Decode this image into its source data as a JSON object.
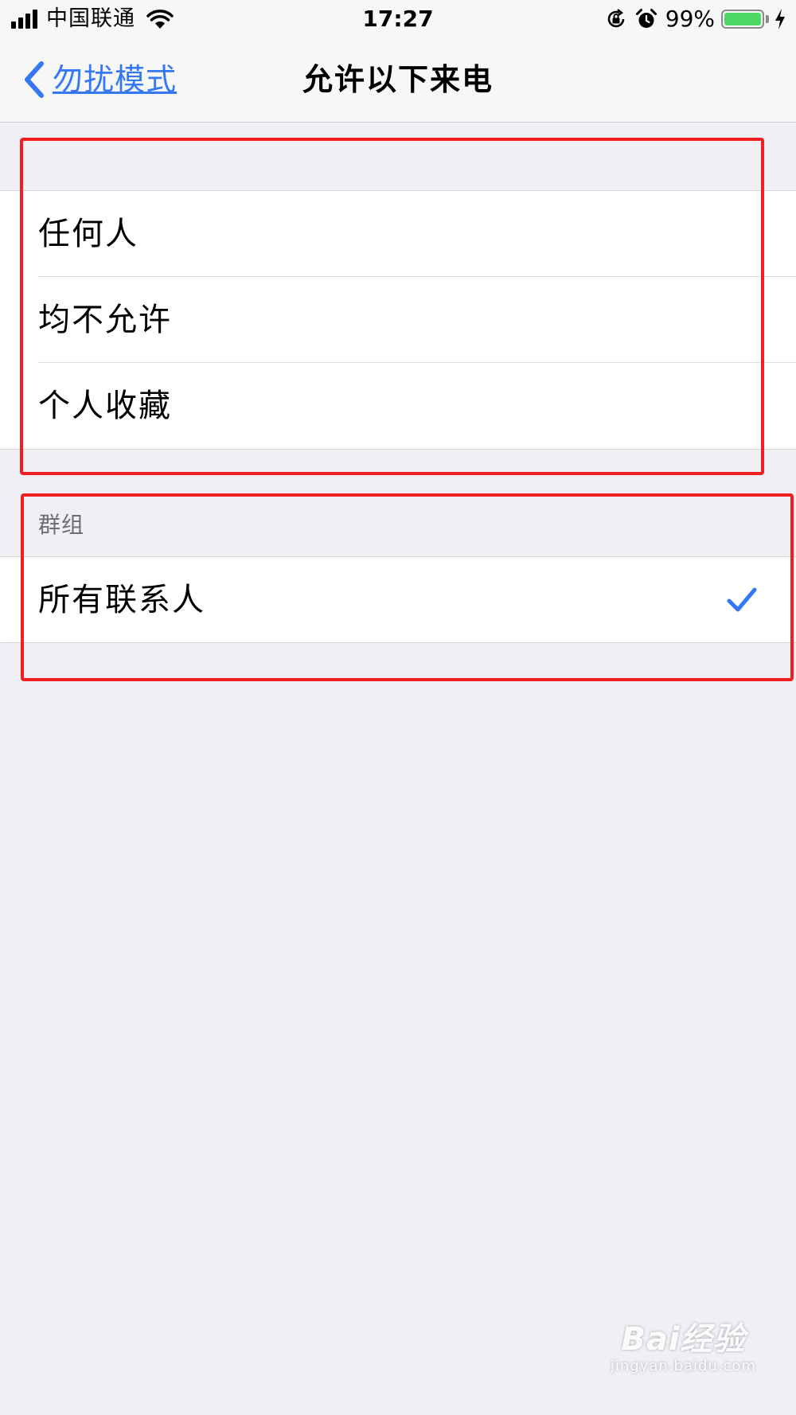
{
  "status_bar": {
    "carrier": "中国联通",
    "time": "17:27",
    "battery_percent": "99%",
    "battery_level": 0.99,
    "battery_color": "#4cd964",
    "icons": [
      "signal-icon",
      "wifi-icon",
      "orientation-lock-icon",
      "alarm-icon",
      "battery-icon",
      "charging-bolt-icon"
    ]
  },
  "nav": {
    "back_label": "勿扰模式",
    "title": "允许以下来电",
    "accent_color": "#3478f6"
  },
  "group1": {
    "items": [
      {
        "label": "任何人"
      },
      {
        "label": "均不允许"
      },
      {
        "label": "个人收藏"
      }
    ]
  },
  "group2": {
    "header": "群组",
    "items": [
      {
        "label": "所有联系人",
        "selected": true
      }
    ]
  },
  "annotations": {
    "highlight_color": "#f02020"
  },
  "watermark": {
    "logo": "Bai经验",
    "sub": "jingyan.baidu.com"
  }
}
